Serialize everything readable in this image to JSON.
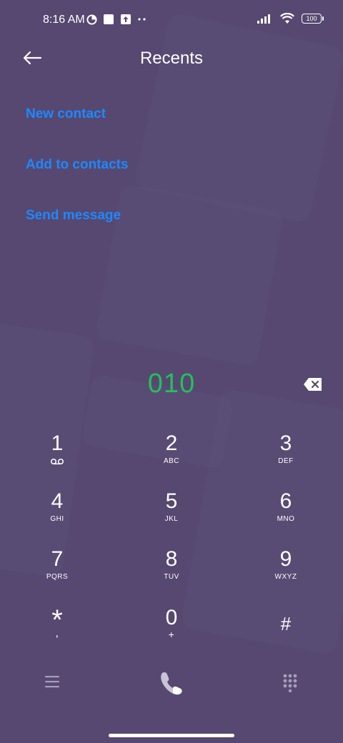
{
  "status_bar": {
    "time": "8:16 AM",
    "battery": "100",
    "icons": [
      "data-saver-icon",
      "square-notification-icon",
      "upload-icon",
      "more-dots-icon",
      "signal-icon",
      "wifi-icon",
      "battery-icon"
    ]
  },
  "header": {
    "title": "Recents",
    "back_icon": "back-arrow-icon"
  },
  "actions": [
    {
      "label": "New contact"
    },
    {
      "label": "Add to contacts"
    },
    {
      "label": "Send message"
    }
  ],
  "dialer": {
    "number": "010",
    "keys": [
      {
        "digit": "1",
        "letters": ""
      },
      {
        "digit": "2",
        "letters": "ABC"
      },
      {
        "digit": "3",
        "letters": "DEF"
      },
      {
        "digit": "4",
        "letters": "GHI"
      },
      {
        "digit": "5",
        "letters": "JKL"
      },
      {
        "digit": "6",
        "letters": "MNO"
      },
      {
        "digit": "7",
        "letters": "PQRS"
      },
      {
        "digit": "8",
        "letters": "TUV"
      },
      {
        "digit": "9",
        "letters": "WXYZ"
      },
      {
        "digit": "*",
        "letters": ","
      },
      {
        "digit": "0",
        "letters": "+"
      },
      {
        "digit": "#",
        "letters": ""
      }
    ]
  },
  "bottom_bar": {
    "icons": [
      "menu-icon",
      "call-icon",
      "dialpad-icon"
    ]
  },
  "colors": {
    "background": "#564870",
    "accent_link": "#1e88ff",
    "number": "#23c05b"
  }
}
